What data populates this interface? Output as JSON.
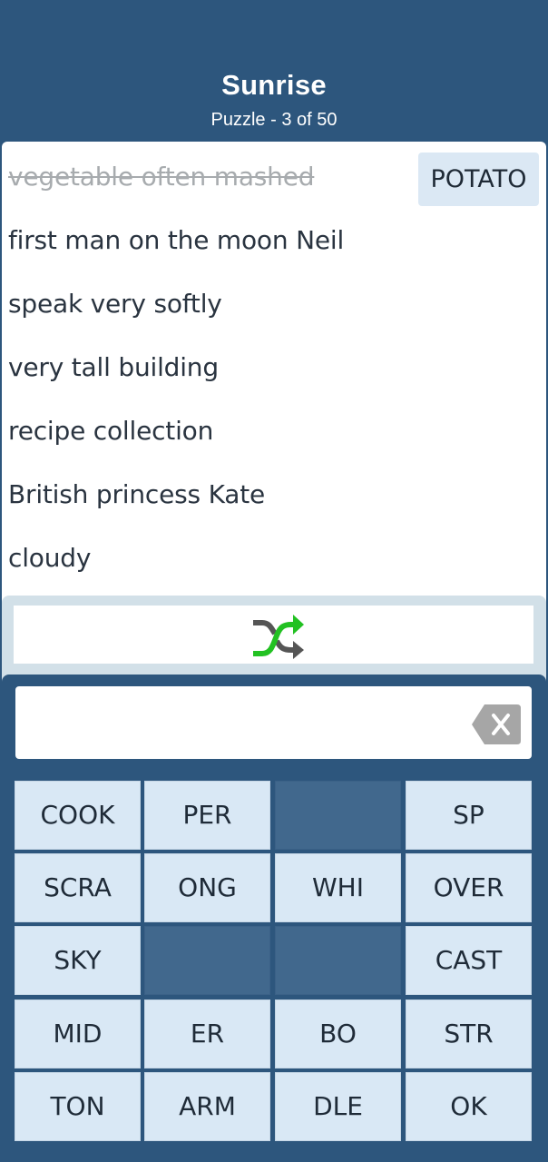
{
  "header": {
    "title": "Sunrise",
    "subtitle": "Puzzle - 3 of 50"
  },
  "clues": [
    {
      "text": "vegetable often mashed",
      "solved": true,
      "answer": "POTATO"
    },
    {
      "text": "first man on the moon Neil",
      "solved": false,
      "answer": ""
    },
    {
      "text": "speak very softly",
      "solved": false,
      "answer": ""
    },
    {
      "text": "very tall building",
      "solved": false,
      "answer": ""
    },
    {
      "text": "recipe collection",
      "solved": false,
      "answer": ""
    },
    {
      "text": "British princess Kate",
      "solved": false,
      "answer": ""
    },
    {
      "text": "cloudy",
      "solved": false,
      "answer": ""
    }
  ],
  "shuffle": {
    "icon": "shuffle-icon",
    "colors": {
      "primary": "#22c122",
      "secondary": "#555555"
    }
  },
  "input": {
    "value": "",
    "placeholder": "",
    "backspace_icon": "backspace-icon"
  },
  "tiles": [
    {
      "label": "COOK",
      "used": false
    },
    {
      "label": "PER",
      "used": false
    },
    {
      "label": "",
      "used": true
    },
    {
      "label": "SP",
      "used": false
    },
    {
      "label": "SCRA",
      "used": false
    },
    {
      "label": "ONG",
      "used": false
    },
    {
      "label": "WHI",
      "used": false
    },
    {
      "label": "OVER",
      "used": false
    },
    {
      "label": "SKY",
      "used": false
    },
    {
      "label": "",
      "used": true
    },
    {
      "label": "",
      "used": true
    },
    {
      "label": "CAST",
      "used": false
    },
    {
      "label": "MID",
      "used": false
    },
    {
      "label": "ER",
      "used": false
    },
    {
      "label": "BO",
      "used": false
    },
    {
      "label": "STR",
      "used": false
    },
    {
      "label": "TON",
      "used": false
    },
    {
      "label": "ARM",
      "used": false
    },
    {
      "label": "DLE",
      "used": false
    },
    {
      "label": "OK",
      "used": false
    }
  ],
  "colors": {
    "header_bg": "#2d567d",
    "tile_bg": "#d9e8f5",
    "tile_used_bg": "#41688d",
    "answer_chip_bg": "#dbe8f4"
  }
}
